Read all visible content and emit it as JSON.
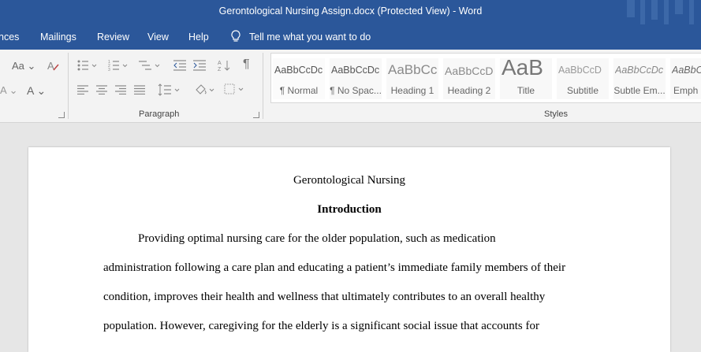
{
  "window": {
    "title": "Gerontological Nursing Assign.docx (Protected View)  -  Word"
  },
  "menu": {
    "items": [
      "nces",
      "Mailings",
      "Review",
      "View",
      "Help"
    ],
    "tell_me": "Tell me what you want to do"
  },
  "ribbon": {
    "font_grow_label": "Aa",
    "font_color_label": "A",
    "paragraph_label": "Paragraph",
    "styles_label": "Styles",
    "pilcrow": "¶",
    "styles": [
      {
        "preview": "AaBbCcDc",
        "name": "¶ Normal"
      },
      {
        "preview": "AaBbCcDc",
        "name": "¶ No Spac..."
      },
      {
        "preview": "AaBbCc",
        "name": "Heading 1"
      },
      {
        "preview": "AaBbCcD",
        "name": "Heading 2"
      },
      {
        "preview": "AaB",
        "name": "Title"
      },
      {
        "preview": "AaBbCcD",
        "name": "Subtitle"
      },
      {
        "preview": "AaBbCcDc",
        "name": "Subtle Em..."
      },
      {
        "preview": "AaBbCcDc",
        "name": "Emph"
      }
    ]
  },
  "document": {
    "title": "Gerontological Nursing",
    "heading": "Introduction",
    "lines": [
      "Providing optimal nursing care for the older population, such as medication",
      "administration following a care plan and educating a patient’s immediate family members of their",
      "condition, improves their health and wellness that ultimately contributes to an overall healthy",
      "population. However, caregiving for the elderly is a significant social issue that accounts for"
    ]
  },
  "colors": {
    "titlebar": "#2b579a",
    "ribbon": "#f3f3f3",
    "canvas": "#e6e6e6",
    "page": "#ffffff"
  }
}
